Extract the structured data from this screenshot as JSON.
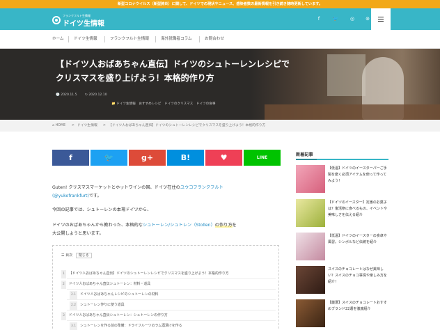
{
  "notice": "新型コロナウイルス（新型肺炎）に関して、ドイツでの現状やニュース、感染者数の最新情報を引き続き随時更新しています。",
  "header": {
    "logo_sub": "フランクフルト生情報",
    "logo_main": "ドイツ生情報",
    "social_icons": [
      {
        "name": "facebook-icon",
        "glyph": "f"
      },
      {
        "name": "twitter-icon",
        "glyph": "🐦"
      },
      {
        "name": "instagram-icon",
        "glyph": "◎"
      },
      {
        "name": "rss-icon",
        "glyph": "⊚"
      }
    ],
    "accent": "#38b6c7"
  },
  "nav": {
    "items": [
      "ホーム",
      "ドイツ生情報",
      "フランクフルト生情報",
      "海外就職者コラム",
      "お問合わせ"
    ]
  },
  "hero": {
    "title": "【ドイツ人おばあちゃん直伝】ドイツのシュトーレンレシピでクリスマスを盛り上げよう！本格的作り方",
    "date_published": "2020.11.5",
    "date_updated": "2020.12.10",
    "tags": "ドイツ生情報　おすすめレシピ　ドイツのクリスマス　ドイツの食事"
  },
  "breadcrumb": [
    "HOME",
    "ドイツ生情報",
    "【ドイツ人おばあちゃん直伝】ドイツのシュトーレンレシピでクリスマスを盛り上げよう！本格的作り方"
  ],
  "share": [
    {
      "name": "facebook-share-button",
      "glyph": "f",
      "color": "#3b5998"
    },
    {
      "name": "twitter-share-button",
      "glyph": "🐦",
      "color": "#1da1f2"
    },
    {
      "name": "googleplus-share-button",
      "glyph": "g+",
      "color": "#dd4b39"
    },
    {
      "name": "hatena-share-button",
      "glyph": "B!",
      "color": "#008fde"
    },
    {
      "name": "pocket-share-button",
      "glyph": "♥",
      "color": "#ef4056"
    },
    {
      "name": "line-share-button",
      "glyph": "LINE",
      "color": "#00c300"
    }
  ],
  "article": {
    "p1_a": "Guten! クリスマスマーケットとホットワインの国、ドイツ在住の",
    "p1_link": "ユウコフランクフルト",
    "p1_b": "",
    "p1_link2": "(@yukofrankfurt)",
    "p1_c": "です。",
    "p2": "今回の記事では、シュトーレンの本場ドイツから、",
    "p3_a": "ドイツのおばあちゃんから教わった、本格的な",
    "p3_link": "シュトーレン/シュトレン（Stollen）",
    "p3_hl": "の作り方",
    "p3_b": "を",
    "p3_c": "大公開しようと思います。"
  },
  "toc": {
    "label": "目次",
    "toggle": "閉じる",
    "items": [
      {
        "num": "1",
        "text": "【ドイツ人おばあちゃん直伝】ドイツのシュトーレンレシピでクリスマスを盛り上げよう！本格的作り方"
      },
      {
        "num": "2",
        "text": "ドイツ人おばあちゃん直伝シュトーレン：材料・道具"
      },
      {
        "num": "2.1",
        "text": "ドイツ人おばあちゃんレシピのシュトーレンの材料"
      },
      {
        "num": "2.2",
        "text": "シュトーレン作りに使う道具"
      },
      {
        "num": "3",
        "text": "ドイツ人おばあちゃん直伝シュトーレン：シュトーレンの作り方"
      },
      {
        "num": "3.1",
        "text": "シュトーレンを作る前の準備：ドライフルーツのラム酒漬けを作る"
      }
    ]
  },
  "sidebar": {
    "title": "新着記事",
    "posts": [
      {
        "text": "【低温】ドイツのイースターパーご手製を磨く必須アイテムを使って作ってみよう！",
        "color": "#e88aa0"
      },
      {
        "text": "【ドイツのイースター】定番のお菓子は？復活祭に食べるもの、イベントや美味しさを伝える紹介",
        "color": "#b9c94e"
      },
      {
        "text": "【低温】ドイツのイースターの食卓や風習。シンボルなど伝統を紹介",
        "color": "#d8b6c2"
      },
      {
        "text": "スイスのチョコレートはなぜ美味しい？スイスのチョコ事情や楽しみ方を紹介！",
        "color": "#4a2e24"
      },
      {
        "text": "【厳選】スイスのチョコレートおすすめブランド22選を徹底紹介",
        "color": "#5a3a22"
      }
    ]
  }
}
